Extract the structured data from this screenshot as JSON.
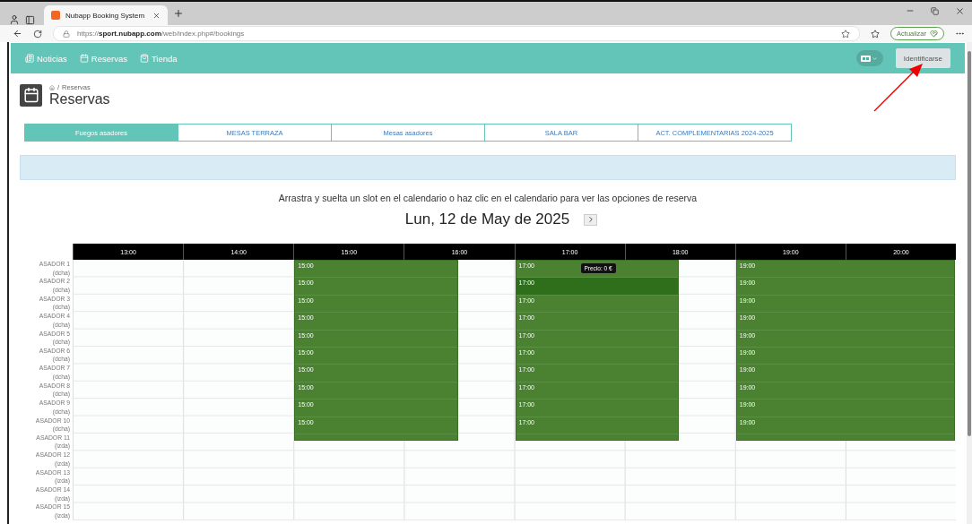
{
  "browser": {
    "tab_title": "Nubapp Booking System",
    "url_scheme": "https://",
    "url_host": "sport.nubapp.com",
    "url_path": "/web/index.php#/bookings",
    "update_button": "Actualizar"
  },
  "nav": {
    "items": [
      {
        "label": "Noticias",
        "kind": "news"
      },
      {
        "label": "Reservas",
        "kind": "calendar"
      },
      {
        "label": "Tienda",
        "kind": "shop"
      }
    ],
    "login_button": "Identificarse"
  },
  "page": {
    "separator": "/",
    "breadcrumb": "Reservas",
    "title": "Reservas"
  },
  "tabs": [
    {
      "label": "Fuegos asadores",
      "selected": true
    },
    {
      "label": "MESAS TERRAZA",
      "selected": false
    },
    {
      "label": "Mesas asadores",
      "selected": false
    },
    {
      "label": "SALA BAR",
      "selected": false
    },
    {
      "label": "ACT. COMPLEMENTARIAS 2024-2025",
      "selected": false
    }
  ],
  "instructions": "Arrastra y suelta un slot en el calendario o haz clic en el calendario para ver las opciones de reserva",
  "date": "Lun, 12 de May de 2025",
  "calendar": {
    "hours": [
      "13:00",
      "14:00",
      "15:00",
      "16:00",
      "17:00",
      "18:00",
      "19:00",
      "20:00"
    ],
    "rows": [
      {
        "name": "ASADOR 1",
        "side": "(dcha)"
      },
      {
        "name": "ASADOR 2",
        "side": "(dcha)"
      },
      {
        "name": "ASADOR 3",
        "side": "(dcha)"
      },
      {
        "name": "ASADOR 4",
        "side": "(dcha)"
      },
      {
        "name": "ASADOR 5",
        "side": "(dcha)"
      },
      {
        "name": "ASADOR 6",
        "side": "(dcha)"
      },
      {
        "name": "ASADOR 7",
        "side": "(dcha)"
      },
      {
        "name": "ASADOR 8",
        "side": "(dcha)"
      },
      {
        "name": "ASADOR 9",
        "side": "(dcha)"
      },
      {
        "name": "ASADOR 10",
        "side": "(dcha)"
      },
      {
        "name": "ASADOR 11",
        "side": "(izda)"
      },
      {
        "name": "ASADOR 12",
        "side": "(izda)"
      },
      {
        "name": "ASADOR 13",
        "side": "(izda)"
      },
      {
        "name": "ASADOR 14",
        "side": "(izda)"
      },
      {
        "name": "ASADOR 15",
        "side": "(izda)"
      }
    ],
    "blocks": [
      {
        "slots": [
          {
            "time": "15:00",
            "highlighted": false
          },
          {
            "time": "15:00",
            "highlighted": false
          },
          {
            "time": "15:00",
            "highlighted": false
          },
          {
            "time": "15:00",
            "highlighted": false
          },
          {
            "time": "15:00",
            "highlighted": false
          },
          {
            "time": "15:00",
            "highlighted": false
          },
          {
            "time": "15:00",
            "highlighted": false
          },
          {
            "time": "15:00",
            "highlighted": false
          },
          {
            "time": "15:00",
            "highlighted": false
          },
          {
            "time": "15:00",
            "highlighted": false
          }
        ]
      },
      {
        "slots": [
          {
            "time": "17:00",
            "highlighted": false
          },
          {
            "time": "17:00",
            "highlighted": true,
            "tooltip": "Precio: 0 €"
          },
          {
            "time": "17:00",
            "highlighted": false
          },
          {
            "time": "17:00",
            "highlighted": false
          },
          {
            "time": "17:00",
            "highlighted": false
          },
          {
            "time": "17:00",
            "highlighted": false
          },
          {
            "time": "17:00",
            "highlighted": false
          },
          {
            "time": "17:00",
            "highlighted": false
          },
          {
            "time": "17:00",
            "highlighted": false
          },
          {
            "time": "17:00",
            "highlighted": false
          }
        ]
      },
      {
        "slots": [
          {
            "time": "19:00",
            "highlighted": false
          },
          {
            "time": "19:00",
            "highlighted": false
          },
          {
            "time": "19:00",
            "highlighted": false
          },
          {
            "time": "19:00",
            "highlighted": false
          },
          {
            "time": "19:00",
            "highlighted": false
          },
          {
            "time": "19:00",
            "highlighted": false
          },
          {
            "time": "19:00",
            "highlighted": false
          },
          {
            "time": "19:00",
            "highlighted": false
          },
          {
            "time": "19:00",
            "highlighted": false
          },
          {
            "time": "19:00",
            "highlighted": false
          }
        ]
      }
    ]
  }
}
